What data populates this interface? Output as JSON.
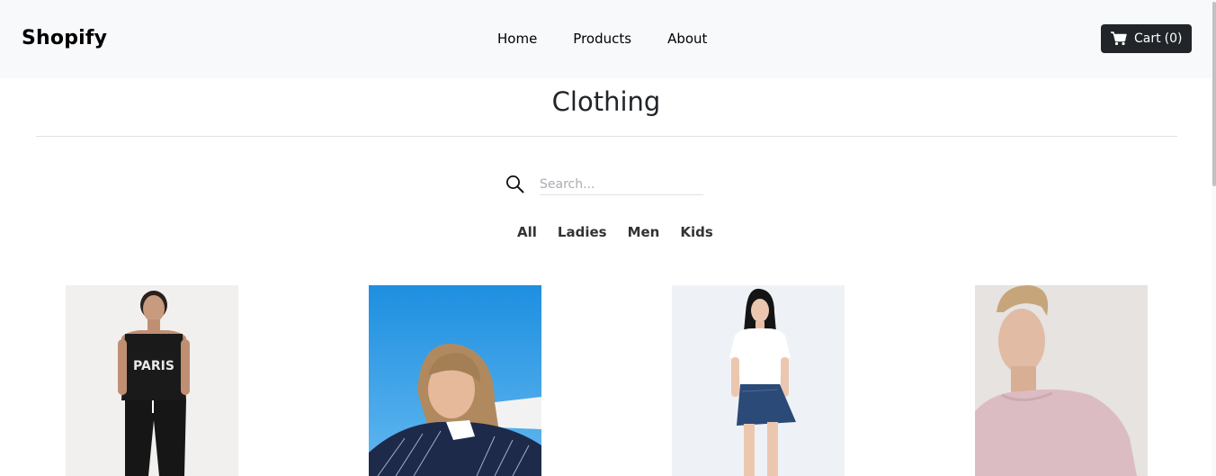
{
  "navbar": {
    "brand": "Shopify",
    "links": [
      {
        "label": "Home"
      },
      {
        "label": "Products"
      },
      {
        "label": "About"
      }
    ],
    "cart": {
      "label": "Cart",
      "count_text": "(0)",
      "icon": "cart-icon"
    }
  },
  "page": {
    "title": "Clothing"
  },
  "search": {
    "placeholder": "Search...",
    "value": "",
    "icon": "search-icon"
  },
  "filters": [
    {
      "label": "All"
    },
    {
      "label": "Ladies"
    },
    {
      "label": "Men"
    },
    {
      "label": "Kids"
    }
  ],
  "products": [
    {
      "image": "man-black-paris-tank-top",
      "shirt_text": "PARIS"
    },
    {
      "image": "woman-navy-striped-shirt-blue-sky"
    },
    {
      "image": "woman-white-polo-denim-skirt"
    },
    {
      "image": "man-pink-tshirt"
    }
  ],
  "colors": {
    "navbar_bg": "#f8f9fa",
    "cart_bg": "#212529",
    "text": "#212529"
  }
}
